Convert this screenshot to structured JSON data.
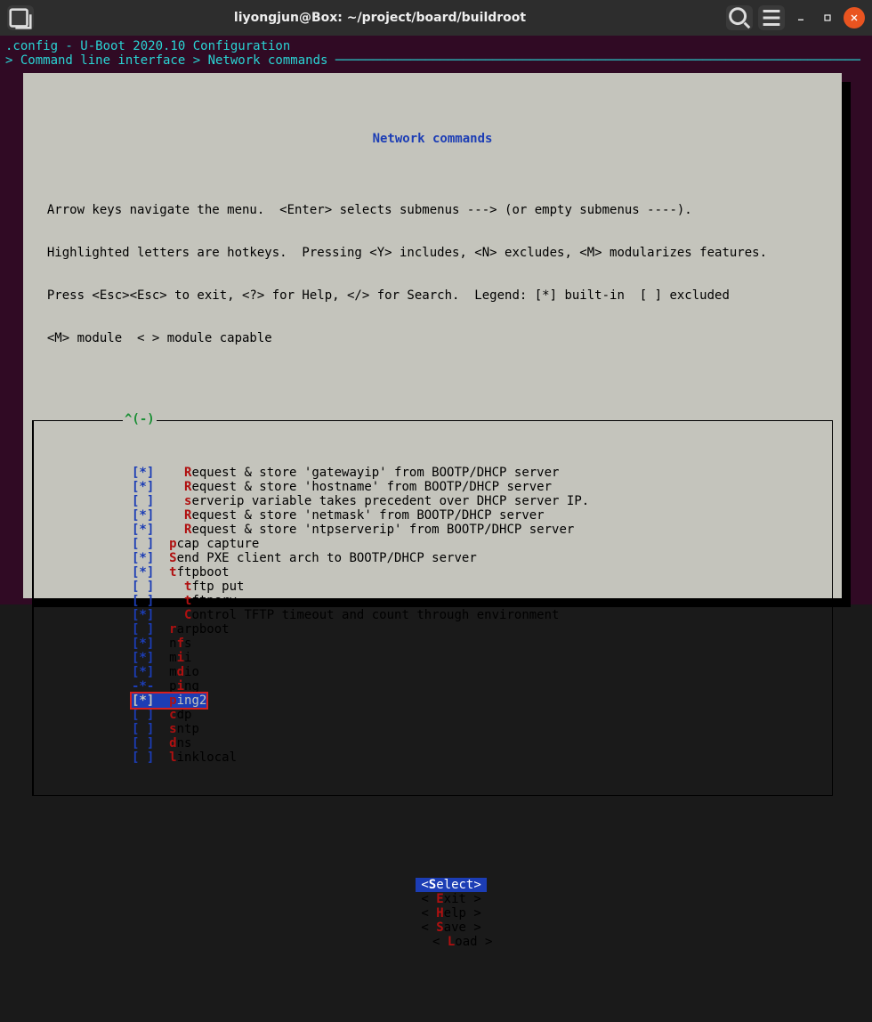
{
  "title": "liyongjun@Box: ~/project/board/buildroot",
  "header1": ".config - U-Boot 2020.10 Configuration",
  "header2": "> Command line interface > Network commands ",
  "menu_title": "Network commands",
  "help": [
    "  Arrow keys navigate the menu.  <Enter> selects submenus ---> (or empty submenus ----).",
    "  Highlighted letters are hotkeys.  Pressing <Y> includes, <N> excludes, <M> modularizes features.",
    "  Press <Esc><Esc> to exit, <?> for Help, </> for Search.  Legend: [*] built-in  [ ] excluded",
    "  <M> module  < > module capable"
  ],
  "scroll": "^(-)",
  "items": [
    {
      "br": "[*]",
      "ind": "    ",
      "k": "R",
      "rest": "equest & store 'gatewayip' from BOOTP/DHCP server"
    },
    {
      "br": "[*]",
      "ind": "    ",
      "k": "R",
      "rest": "equest & store 'hostname' from BOOTP/DHCP server"
    },
    {
      "br": "[ ]",
      "ind": "    ",
      "k": "s",
      "rest": "erverip variable takes precedent over DHCP server IP."
    },
    {
      "br": "[*]",
      "ind": "    ",
      "k": "R",
      "rest": "equest & store 'netmask' from BOOTP/DHCP server"
    },
    {
      "br": "[*]",
      "ind": "    ",
      "k": "R",
      "rest": "equest & store 'ntpserverip' from BOOTP/DHCP server"
    },
    {
      "br": "[ ]",
      "ind": "  ",
      "k": "p",
      "rest": "cap capture"
    },
    {
      "br": "[*]",
      "ind": "  ",
      "k": "S",
      "rest": "end PXE client arch to BOOTP/DHCP server"
    },
    {
      "br": "[*]",
      "ind": "  ",
      "k": "t",
      "rest": "ftpboot"
    },
    {
      "br": "[ ]",
      "ind": "    ",
      "k": "t",
      "rest": "ftp put"
    },
    {
      "br": "[ ]",
      "ind": "    ",
      "k": "t",
      "rest": "ftpsrv"
    },
    {
      "br": "[*]",
      "ind": "    ",
      "k": "C",
      "rest": "ontrol TFTP timeout and count through environment"
    },
    {
      "br": "[ ]",
      "ind": "  ",
      "k": "r",
      "rest": "arpboot"
    },
    {
      "br": "[*]",
      "ind": "  ",
      "k": "",
      "rest": "n",
      "k2": "f",
      "rest2": "s"
    },
    {
      "br": "[*]",
      "ind": "  ",
      "k": "",
      "rest": "m",
      "k2": "i",
      "rest2": "i"
    },
    {
      "br": "[*]",
      "ind": "  ",
      "k": "",
      "rest": "m",
      "k2": "d",
      "rest2": "io"
    },
    {
      "br": "-*-",
      "ind": "  ",
      "k": "",
      "rest": "p",
      "k2": "i",
      "rest2": "ng"
    },
    {
      "br": "[*]",
      "ind": "  ",
      "k": "p",
      "rest": "ing2",
      "sel": true,
      "hl": true
    },
    {
      "br": "[ ]",
      "ind": "  ",
      "k": "c",
      "rest": "dp"
    },
    {
      "br": "[ ]",
      "ind": "  ",
      "k": "s",
      "rest": "ntp"
    },
    {
      "br": "[ ]",
      "ind": "  ",
      "k": "d",
      "rest": "ns"
    },
    {
      "br": "[ ]",
      "ind": "  ",
      "k": "l",
      "rest": "inklocal"
    }
  ],
  "buttons": {
    "select": {
      "open": "<",
      "key": "S",
      "rest": "elect>",
      "active": true
    },
    "exit": {
      "open": "< ",
      "key": "E",
      "rest": "xit >"
    },
    "help": {
      "open": "< ",
      "key": "H",
      "rest": "elp >"
    },
    "save": {
      "open": "< ",
      "key": "S",
      "rest": "ave >"
    },
    "load": {
      "open": "< ",
      "key": "L",
      "rest": "oad >"
    }
  }
}
